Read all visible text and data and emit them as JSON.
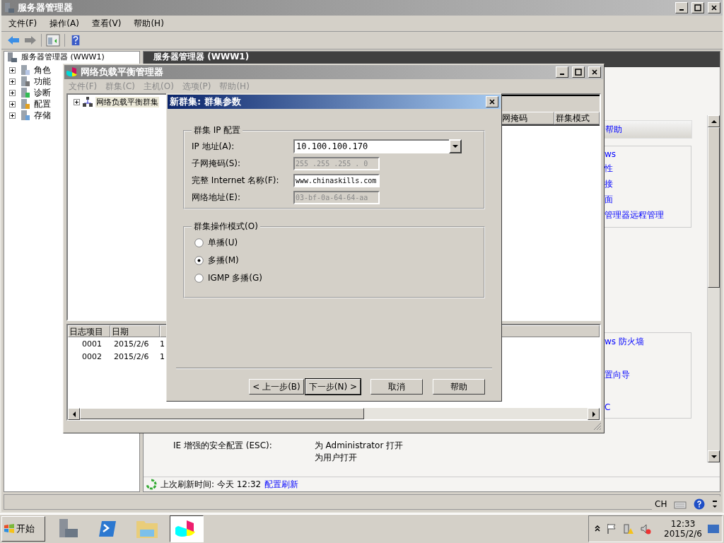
{
  "server_manager": {
    "title": "服务器管理器",
    "menu": [
      "文件(F)",
      "操作(A)",
      "查看(V)",
      "帮助(H)"
    ],
    "tree_root": "服务器管理器 (WWW1)",
    "tree": [
      {
        "label": "角色",
        "expanded": false
      },
      {
        "label": "功能",
        "expanded": false
      },
      {
        "label": "诊断",
        "expanded": false
      },
      {
        "label": "配置",
        "expanded": false
      },
      {
        "label": "存储",
        "expanded": false
      }
    ],
    "pane_header": "服务器管理器 (WWW1)",
    "help_title": "帮助",
    "help_links": [
      "ws",
      "性",
      "接",
      "面",
      "管理器远程管理"
    ],
    "links": [
      "ws 防火墙",
      "置向导",
      "C"
    ],
    "ie_esc": {
      "label": "IE 增强的安全配置 (ESC):",
      "values": [
        "为 Administrator 打开",
        "为用户打开"
      ]
    },
    "refresh": {
      "text": "上次刷新时间: 今天 12:32",
      "link": "配置刷新"
    }
  },
  "nlb": {
    "title": "网络负载平衡管理器",
    "menu": [
      {
        "label": "文件(F)",
        "disabled": true
      },
      {
        "label": "群集(C)",
        "disabled": true
      },
      {
        "label": "主机(O)",
        "disabled": true
      },
      {
        "label": "选项(P)",
        "disabled": true
      },
      {
        "label": "帮助(H)",
        "disabled": true
      }
    ],
    "tree": [
      {
        "label": "网络负载平衡群集",
        "expanded": false
      }
    ],
    "columns": [
      "网掩码",
      "群集模式"
    ],
    "log_columns": [
      "日志项目",
      "日期"
    ],
    "log_rows": [
      [
        "0001",
        "2015/2/6",
        "1"
      ],
      [
        "0002",
        "2015/2/6",
        "1"
      ]
    ]
  },
  "dialog": {
    "title": "新群集:  群集参数",
    "ip_group": "群集 IP 配置",
    "fields": [
      {
        "label": "IP 地址(A):",
        "value": "10.100.100.170",
        "kind": "combo",
        "disabled": false
      },
      {
        "label": "子网掩码(S):",
        "value": "255 .255 .255 . 0",
        "kind": "text",
        "disabled": true
      },
      {
        "label": "完整 Internet 名称(F):",
        "value": "www.chinaskills.com",
        "kind": "text",
        "disabled": false
      },
      {
        "label": "网络地址(E):",
        "value": "03-bf-0a-64-64-aa",
        "kind": "text",
        "disabled": true
      }
    ],
    "mode_group": "群集操作模式(O)",
    "modes": [
      {
        "label": "单播(U)",
        "selected": false
      },
      {
        "label": "多播(M)",
        "selected": true
      },
      {
        "label": "IGMP 多播(G)",
        "selected": false
      }
    ],
    "buttons": [
      {
        "label": "< 上一步(B)",
        "default": false
      },
      {
        "label": "下一步(N) >",
        "default": true
      },
      {
        "label": "取消",
        "default": false
      },
      {
        "label": "帮助",
        "default": false
      }
    ]
  },
  "taskbar": {
    "start": "开始",
    "apps": [
      {
        "kind": "server",
        "selected": false
      },
      {
        "kind": "shell",
        "selected": false
      },
      {
        "kind": "folder",
        "selected": false
      },
      {
        "kind": "chart",
        "selected": true
      }
    ],
    "lang": "CH",
    "time": "12:33",
    "date": "2015/2/6"
  }
}
